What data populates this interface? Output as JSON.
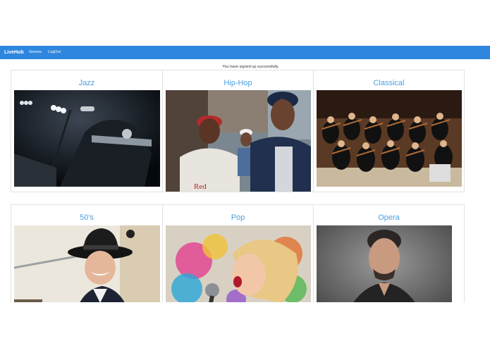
{
  "navbar": {
    "brand": "LiveHub",
    "links": [
      "Genres",
      "LogOut"
    ]
  },
  "flash_message": "You have signed up successfully.",
  "genres": [
    {
      "name": "Jazz",
      "image": "jazz trumpet player on dark stage"
    },
    {
      "name": "Hip-Hop",
      "image": "two hip-hop artists in caps on street"
    },
    {
      "name": "Classical",
      "image": "orchestra violin section"
    },
    {
      "name": "50's",
      "image": "smiling crooner in fedora at microphone"
    },
    {
      "name": "Pop",
      "image": "singer with colorful paint splash and microphone"
    },
    {
      "name": "Opera",
      "image": "man portrait in gray tones"
    }
  ],
  "colors": {
    "navbar": "#2e86de",
    "card_title": "#4a9fe0"
  }
}
